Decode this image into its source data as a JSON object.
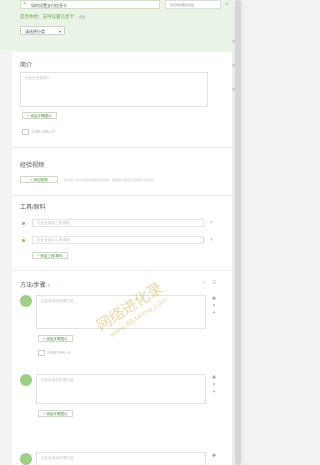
{
  "header": {
    "title_value": "如何设置支付信息卡",
    "related_label": "是否你想：支持设置信息卡",
    "related_sub": "修改",
    "category_value": "请选择分类",
    "side_search_placeholder": "搜索你想要的经验",
    "search_icon": "search-icon"
  },
  "intro": {
    "title": "简介",
    "placeholder": "在此处添加简介",
    "add_image_label": "+ 添加步骤图片",
    "upload_hint": "支持图片拖拽上传"
  },
  "video": {
    "title": "经验视频",
    "add_label": "+ 添加视频",
    "tip": "建议您上传与经验内容相关的视频，帮助用户更加直观地学习和操作"
  },
  "tools": {
    "title": "工具/原料",
    "items": [
      {
        "placeholder": "在此处添加工具/原料"
      },
      {
        "placeholder": "在此处添加工具/原料"
      }
    ],
    "add_label": "+ 添加工具/原料"
  },
  "steps": {
    "title": "方法/步骤",
    "items": [
      {
        "placeholder": "在此处添加步骤内容",
        "add_image_label": "+ 添加步骤图片",
        "upload_hint": "支持图片拖拽上传"
      },
      {
        "placeholder": "在此处添加步骤内容",
        "add_image_label": "+ 添加步骤图片",
        "upload_hint": ""
      },
      {
        "placeholder": "在此处添加步骤内容"
      }
    ]
  },
  "watermark": {
    "text": "网络进化录",
    "url": "www.8844ime.com"
  },
  "colors": {
    "accent": "#7cbf63",
    "header_bg": "#e9f3e6"
  }
}
